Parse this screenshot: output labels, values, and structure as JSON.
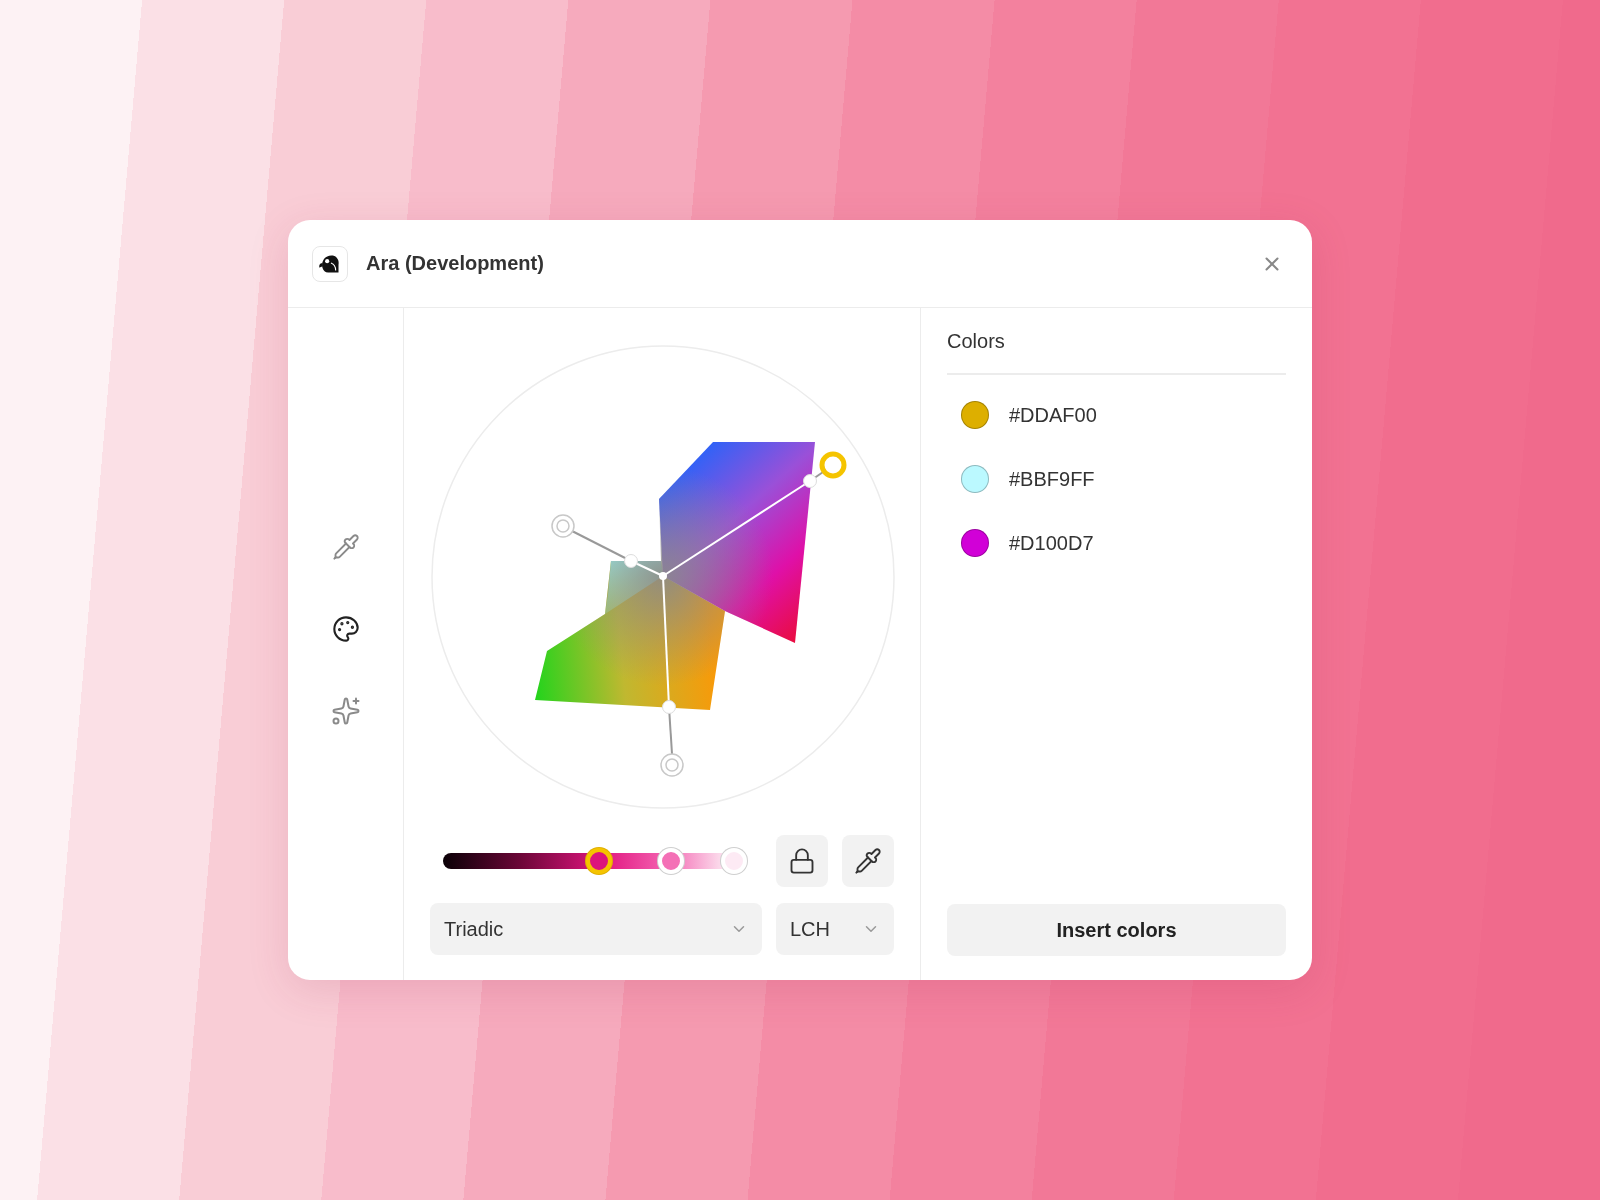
{
  "window": {
    "title": "Ara (Development)"
  },
  "tools": [
    {
      "kind": "pipette",
      "selected": false
    },
    {
      "kind": "palette",
      "selected": true
    },
    {
      "kind": "sparkles",
      "selected": false
    }
  ],
  "lightness_slider": {
    "thumbs": [
      {
        "level": 0.51,
        "selected": true
      },
      {
        "level": 0.745,
        "selected": false
      },
      {
        "level": 0.95,
        "selected": false
      }
    ]
  },
  "harmony_select": {
    "value": "Triadic"
  },
  "space_select": {
    "value": "LCH"
  },
  "colors_panel": {
    "title": "Colors",
    "items": [
      {
        "label": "#DDAF00",
        "color": "#ddaf00"
      },
      {
        "label": "#BBF9FF",
        "color": "#bbf9ff"
      },
      {
        "label": "#D100D7",
        "color": "#d100d7"
      }
    ],
    "button": "Insert colors"
  }
}
